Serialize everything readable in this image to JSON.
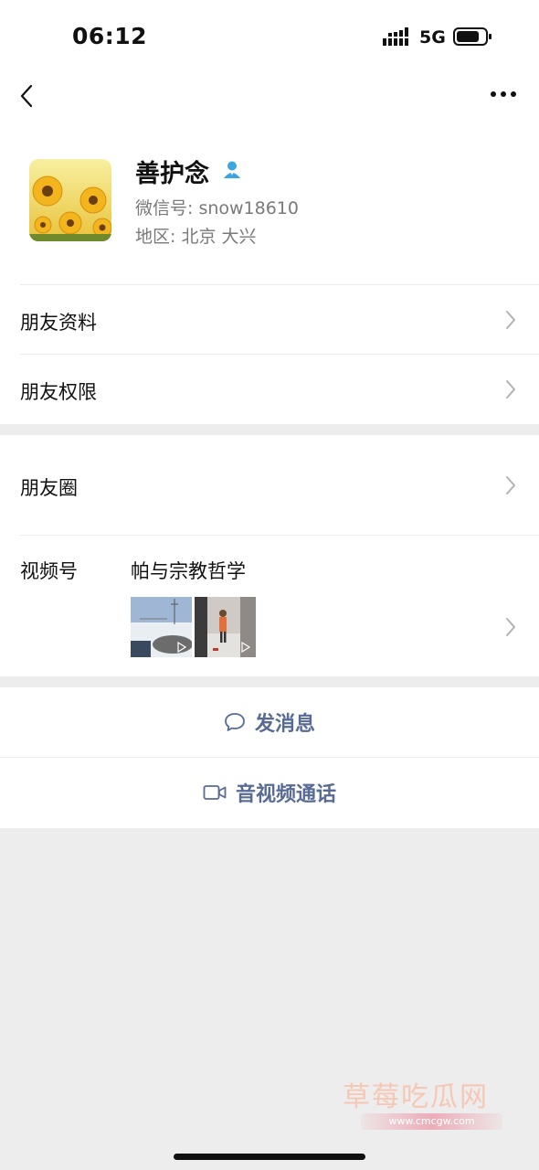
{
  "status_bar": {
    "time": "06:12",
    "network": "5G"
  },
  "profile": {
    "name": "善护念",
    "wechat_id": "微信号: snow18610",
    "region": "地区: 北京 大兴"
  },
  "menu": {
    "friend_info": "朋友资料",
    "friend_permissions": "朋友权限",
    "moments": "朋友圈",
    "channels_label": "视频号",
    "channels_name": "帕与宗教哲学"
  },
  "actions": {
    "message": "发消息",
    "av_call": "音视频通话"
  },
  "watermark": {
    "title": "草莓吃瓜网",
    "url": "www.cmcgw.com"
  },
  "icons": [
    "signal-icon",
    "battery-icon",
    "back-icon",
    "more-icon",
    "contact-icon",
    "chevron-right-icon",
    "chat-bubble-icon",
    "video-camera-icon",
    "play-icon"
  ],
  "colors": {
    "link_blue": "#576b95",
    "contact_icon": "#3ba6e0",
    "background": "#ededed"
  }
}
